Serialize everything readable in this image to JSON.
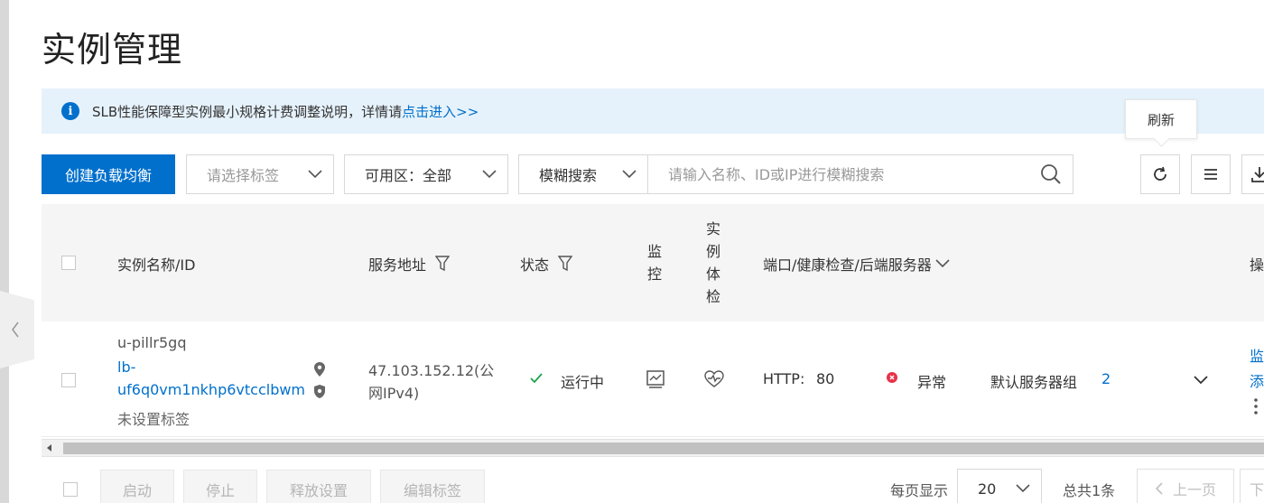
{
  "page": {
    "title": "实例管理"
  },
  "notice": {
    "text": "SLB性能保障型实例最小规格计费调整说明，详情请",
    "link": "点击进入>>"
  },
  "tooltip": {
    "text": "刷新"
  },
  "toolbar": {
    "create_label": "创建负载均衡",
    "tag_placeholder": "请选择标签",
    "zone_label": "可用区：",
    "zone_value": "全部",
    "search_mode": "模糊搜索",
    "search_placeholder": "请输入名称、ID或IP进行模糊搜索"
  },
  "table": {
    "headers": {
      "name": "实例名称/ID",
      "address": "服务地址",
      "status": "状态",
      "monitor": [
        "监",
        "控"
      ],
      "health": [
        "实",
        "例",
        "体",
        "检"
      ],
      "ports": "端口/健康检查/后端服务器",
      "ops": "操"
    },
    "rows": [
      {
        "name": "u-pillr5gq",
        "id_line1": "lb-",
        "id_line2": "uf6q0vm1nkhp6vtcclbwm",
        "tag": "未设置标签",
        "address_line1": "47.103.152.12(公",
        "address_line2": "网IPv4)",
        "status": "运行中",
        "protocol": "HTTP:",
        "port": "80",
        "health": "异常",
        "server_group": "默认服务器组",
        "server_count": "2",
        "op1": "监",
        "op2": "添"
      }
    ]
  },
  "footer": {
    "batch_buttons": [
      "启动",
      "停止",
      "释放设置",
      "编辑标签"
    ],
    "per_page_label": "每页显示",
    "per_page_value": "20",
    "total": "总共1条",
    "prev": "上一页",
    "next": "下"
  },
  "colors": {
    "primary": "#0070cc",
    "notice_bg": "#e6f2fb",
    "running": "#1aa34a",
    "error": "#e8334a"
  }
}
